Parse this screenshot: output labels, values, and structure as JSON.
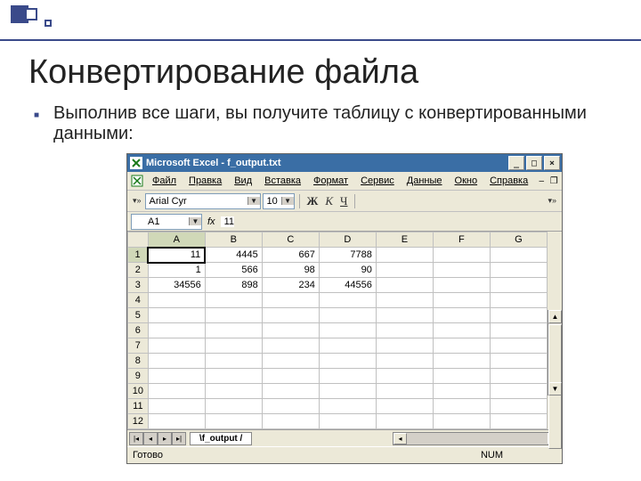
{
  "slide": {
    "title": "Конвертирование файла",
    "bullet": "Выполнив все шаги, вы получите таблицу с конвертированными данными:"
  },
  "window": {
    "title": "Microsoft Excel - f_output.txt",
    "min": "_",
    "max": "□",
    "close": "×"
  },
  "menu": {
    "file": "Файл",
    "edit": "Правка",
    "view": "Вид",
    "insert": "Вставка",
    "format": "Формат",
    "tools": "Сервис",
    "data": "Данные",
    "window": "Окно",
    "help": "Справка"
  },
  "toolbar": {
    "font": "Arial Cyr",
    "size": "10",
    "bold": "Ж",
    "italic": "К",
    "underline": "Ч"
  },
  "formula": {
    "cellref": "A1",
    "fx": "fx",
    "value": "11"
  },
  "columns": [
    "A",
    "B",
    "C",
    "D",
    "E",
    "F",
    "G"
  ],
  "rows": [
    "1",
    "2",
    "3",
    "4",
    "5",
    "6",
    "7",
    "8",
    "9",
    "10",
    "11",
    "12"
  ],
  "cells": {
    "r0": [
      "11",
      "4445",
      "667",
      "7788",
      "",
      "",
      ""
    ],
    "r1": [
      "1",
      "566",
      "98",
      "90",
      "",
      "",
      ""
    ],
    "r2": [
      "34556",
      "898",
      "234",
      "44556",
      "",
      "",
      ""
    ]
  },
  "tabs": {
    "sheet": "f_output"
  },
  "status": {
    "ready": "Готово",
    "num": "NUM"
  },
  "chart_data": {
    "type": "table",
    "columns": [
      "A",
      "B",
      "C",
      "D"
    ],
    "rows": [
      [
        11,
        4445,
        667,
        7788
      ],
      [
        1,
        566,
        98,
        90
      ],
      [
        34556,
        898,
        234,
        44556
      ]
    ]
  }
}
